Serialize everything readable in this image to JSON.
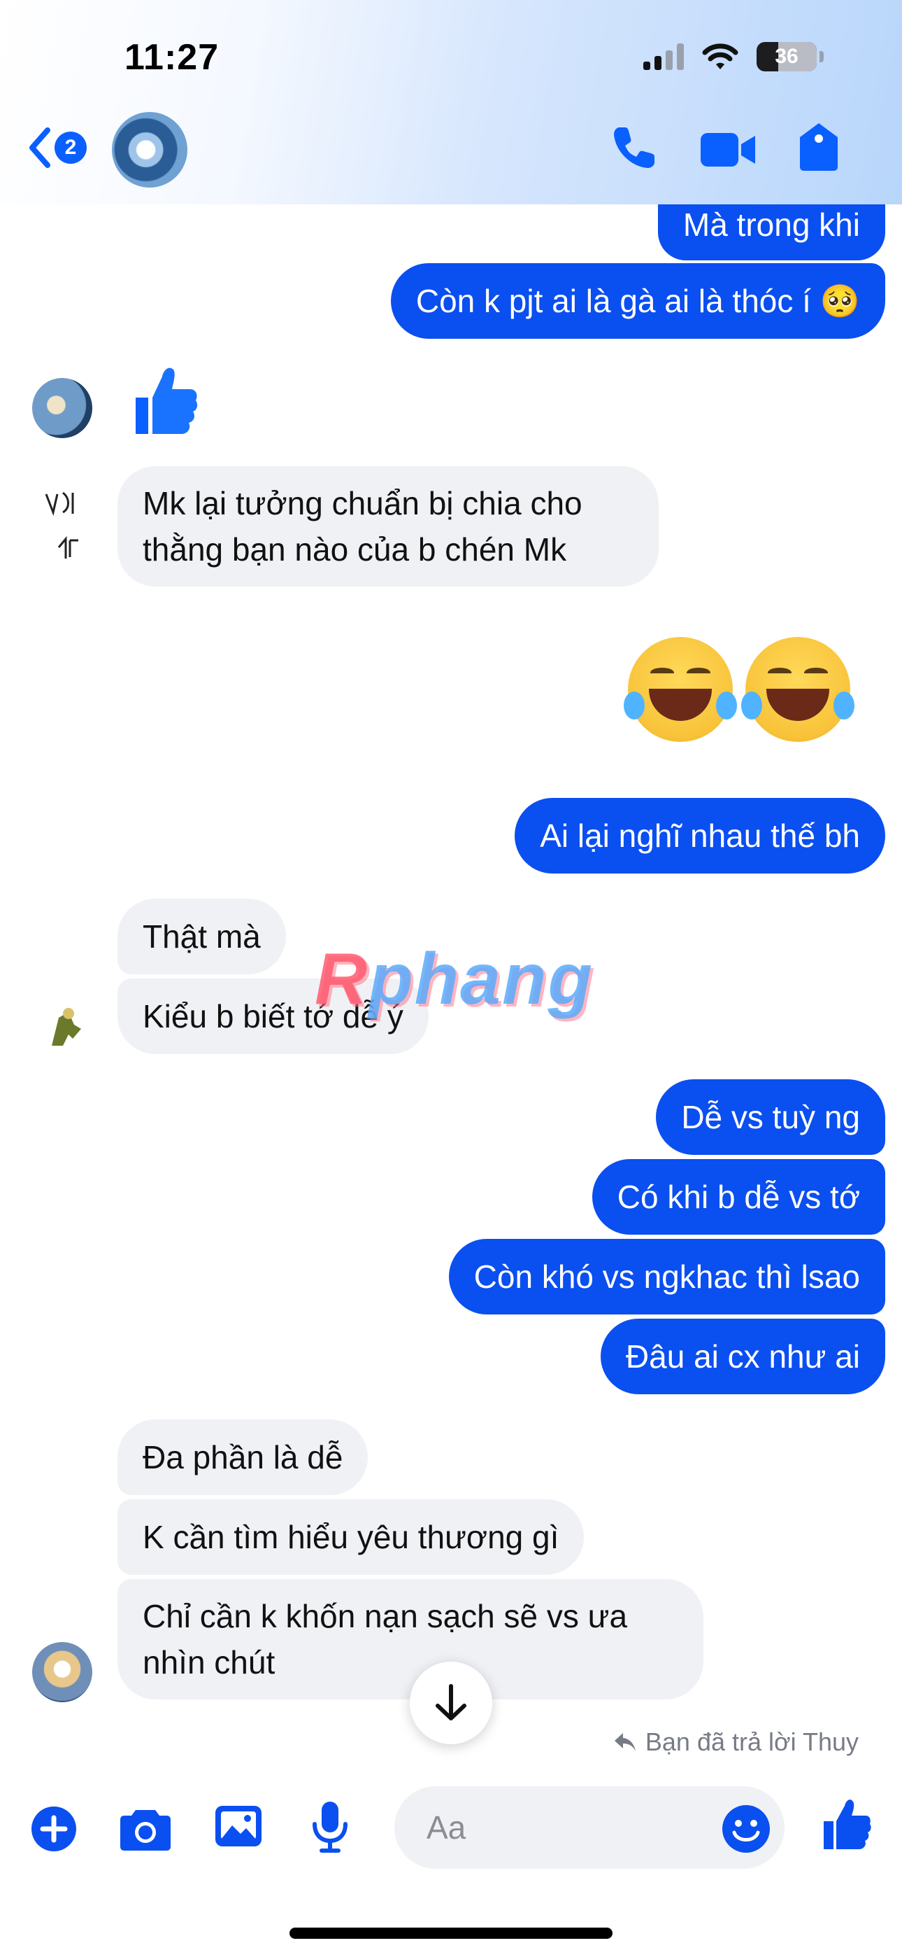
{
  "status_bar": {
    "time": "11:27",
    "battery": "36"
  },
  "header": {
    "back_count": "2"
  },
  "messages": {
    "m1": "Mà trong khi",
    "m2": "Còn k pjt ai là gà ai là thóc í 🥺",
    "m3_line1": "Mk lại tưởng chuẩn bị chia cho",
    "m3_line2": "thằng bạn nào của b chén Mk",
    "m4": "Ai lại nghĩ nhau thế bh",
    "m5": "Thật mà",
    "m6": "Kiểu b biết tớ dễ ý",
    "m7": "Dễ vs tuỳ ng",
    "m8": "Có khi b dễ vs tớ",
    "m9": "Còn khó vs ngkhac thì lsao",
    "m10": "Đâu ai cx như ai",
    "m11": "Đa phần là dễ",
    "m12": "K cần tìm hiểu yêu thương gì",
    "m13_line1": "Chỉ cần k khốn nạn sạch sẽ vs ưa",
    "m13_line2": "nhìn chút"
  },
  "watermark": {
    "first": "R",
    "rest": "phang"
  },
  "reply_note": "Bạn đã trả lời Thuy",
  "composer": {
    "placeholder": "Aa"
  },
  "colors": {
    "outgoing": "#0a4ff0",
    "incoming": "#f0f1f5",
    "accent": "#0a5fff"
  }
}
